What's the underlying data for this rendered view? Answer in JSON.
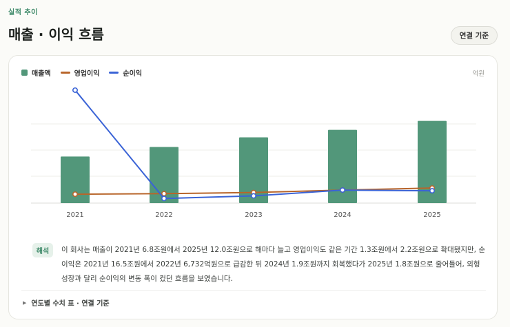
{
  "header": {
    "eyebrow": "실적 추이",
    "title": "매출 · 이익 흐름",
    "basis_button": "연결 기준"
  },
  "colors": {
    "revenue": "#52977a",
    "operating_income": "#b8652a",
    "net_income": "#3a63d6",
    "grid": "#ececea"
  },
  "chart_data": {
    "type": "bar",
    "categories": [
      "2021",
      "2022",
      "2023",
      "2024",
      "2025"
    ],
    "unit_label": "억원",
    "legend_position": "top-left",
    "grid": true,
    "ylim": [
      0,
      175000
    ],
    "series": [
      {
        "name": "매출액",
        "type": "bar",
        "values": [
          68000,
          82000,
          96000,
          107000,
          120000
        ]
      },
      {
        "name": "영업이익",
        "type": "line",
        "values": [
          13000,
          13800,
          15500,
          19000,
          22000
        ]
      },
      {
        "name": "순이익",
        "type": "line",
        "values": [
          165000,
          6732,
          10500,
          19000,
          18000
        ]
      }
    ]
  },
  "interpretation": {
    "badge": "해석",
    "text": "이 회사는 매출이 2021년 6.8조원에서 2025년 12.0조원으로 해마다 늘고 영업이익도 같은 기간 1.3조원에서 2.2조원으로 확대됐지만, 순이익은 2021년 16.5조원에서 2022년 6,732억원으로 급감한 뒤 2024년 1.9조원까지 회복했다가 2025년 1.8조원으로 줄어들어, 외형 성장과 달리 순이익의 변동 폭이 컸던 흐름을 보였습니다."
  },
  "table_toggle": {
    "label": "연도별 수치 표 · 연결 기준"
  }
}
